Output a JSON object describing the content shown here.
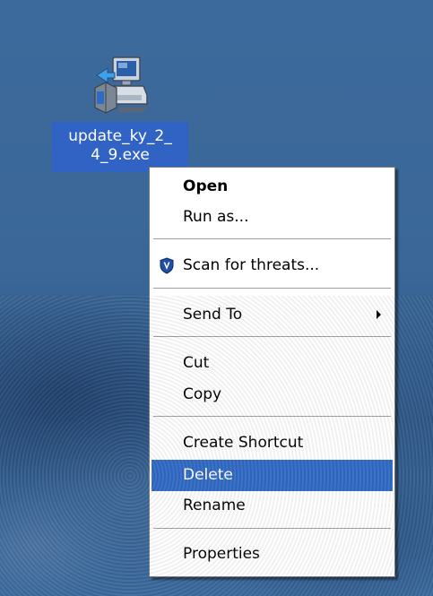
{
  "desktop_icon": {
    "label": "update_ky_2_\n4_9.exe",
    "icon": "installer-computer-icon"
  },
  "context_menu": {
    "items": [
      {
        "label": "Open",
        "bold": true
      },
      {
        "label": "Run as..."
      },
      {
        "label": "Scan for threats...",
        "icon": "antivirus-shield-icon"
      },
      {
        "label": "Send To",
        "submenu": true
      },
      {
        "label": "Cut"
      },
      {
        "label": "Copy"
      },
      {
        "label": "Create Shortcut"
      },
      {
        "label": "Delete",
        "selected": true
      },
      {
        "label": "Rename"
      },
      {
        "label": "Properties"
      }
    ]
  },
  "colors": {
    "selection": "#316ac5",
    "menu_background": "#ffffff",
    "desktop": "#3a6798"
  }
}
